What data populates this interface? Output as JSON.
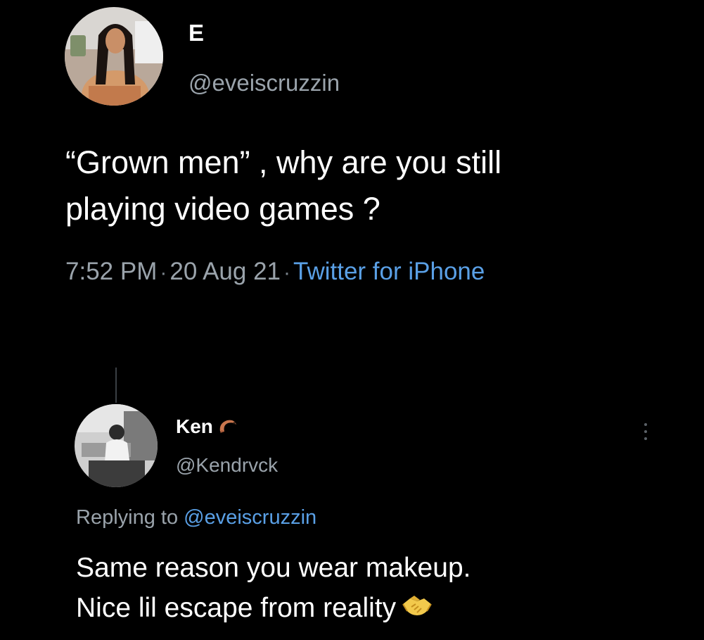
{
  "tweet": {
    "author": {
      "display_name": "E",
      "handle": "@eveiscruzzin"
    },
    "text_lines": [
      "“Grown men” , why are you still",
      "playing video games ?"
    ],
    "time": "7:52 PM",
    "separator": "·",
    "date": "20 Aug 21",
    "source": "Twitter for iPhone"
  },
  "reply": {
    "author": {
      "display_name": "Ken",
      "name_emoji_icon": "shrimp-icon",
      "handle": "@Kendrvck"
    },
    "replying_to_label": "Replying to",
    "replying_to_handle": "@eveiscruzzin",
    "text_lines": [
      "Same reason you wear makeup.",
      "Nice lil escape from reality"
    ],
    "trailing_emoji_icon": "handshake-icon"
  },
  "colors": {
    "background": "#000000",
    "primary_text": "#ffffff",
    "secondary_text": "#9aa3ab",
    "accent_link": "#5aa0e6"
  }
}
